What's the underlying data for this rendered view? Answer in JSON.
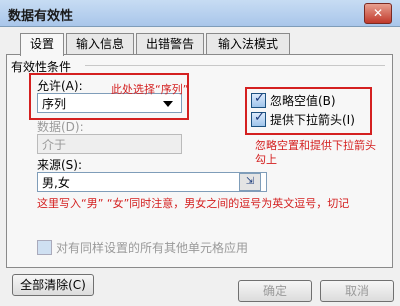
{
  "window": {
    "title": "数据有效性",
    "close_glyph": "✕"
  },
  "tabs": [
    {
      "label": "设置",
      "active": true
    },
    {
      "label": "输入信息",
      "active": false
    },
    {
      "label": "出错警告",
      "active": false
    },
    {
      "label": "输入法模式",
      "active": false
    }
  ],
  "settings": {
    "group_title": "有效性条件",
    "allow_label": "允许(A):",
    "allow_value": "序列",
    "data_label": "数据(D):",
    "data_value": "介于",
    "ignore_blank_label": "忽略空值(B)",
    "ignore_blank_checked": true,
    "dropdown_label": "提供下拉箭头(I)",
    "dropdown_checked": true,
    "source_label": "来源(S):",
    "source_value": "男,女",
    "apply_all_label": "对有同样设置的所有其他单元格应用"
  },
  "annotations": {
    "allow_note": "此处选择“序列”",
    "checkbox_note": "忽略空置和提供下拉箭头勾上",
    "source_note": "这里写入“男” “女”同时注意，男女之间的逗号为英文逗号，切记"
  },
  "buttons": {
    "clear_all": "全部清除(C)",
    "ok": "确定",
    "cancel": "取消"
  },
  "colors": {
    "annotation": "#d42020",
    "titlebar": "#b7d0ef"
  }
}
